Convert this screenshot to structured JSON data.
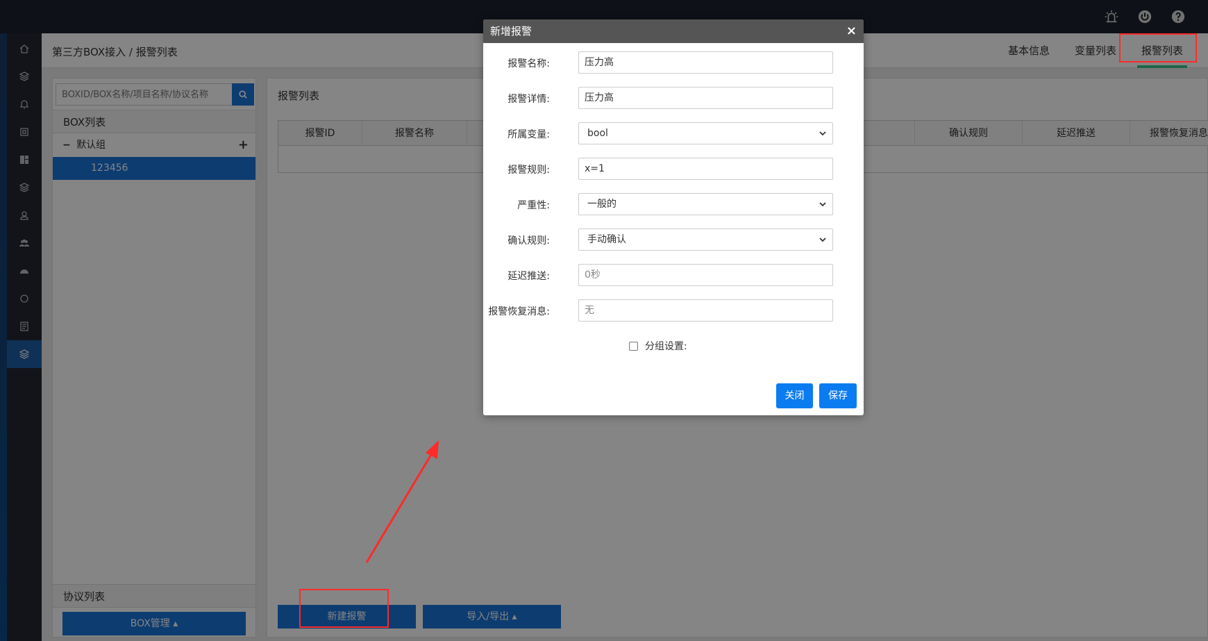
{
  "header": {
    "breadcrumb": "第三方BOX接入 / 报警列表",
    "tabs": [
      {
        "label": "基本信息"
      },
      {
        "label": "变量列表"
      },
      {
        "label": "报警列表"
      }
    ]
  },
  "top_icons": [
    "alarm-light-icon",
    "power-icon",
    "help-icon"
  ],
  "left_nav": [
    "home-icon",
    "layers-icon",
    "bell-icon",
    "device-icon",
    "dashboard-icon",
    "layers-icon",
    "user-icon",
    "users-icon",
    "gauge-icon",
    "cycle-icon",
    "report-icon",
    "layers-icon"
  ],
  "left_panel": {
    "search_placeholder": "BOXID/BOX名称/项目名称/协议名称",
    "box_list_title": "BOX列表",
    "group_name": "默认组",
    "group_collapse": "−",
    "group_add": "+",
    "box_item": "123456",
    "protocol_list_title": "协议列表",
    "box_mgmt_label": "BOX管理 ▴"
  },
  "main": {
    "title": "报警列表",
    "columns": [
      "报警ID",
      "报警名称",
      "确认规则",
      "延迟推送",
      "报警恢复消息"
    ],
    "new_alarm_label": "新建报警",
    "import_export_label": "导入/导出 ▴"
  },
  "modal": {
    "title": "新增报警",
    "close_symbol": "×",
    "fields": {
      "alarm_name": {
        "label": "报警名称:",
        "value": "压力高"
      },
      "alarm_detail": {
        "label": "报警详情:",
        "value": "压力高"
      },
      "variable": {
        "label": "所属变量:",
        "value": "bool"
      },
      "rule": {
        "label": "报警规则:",
        "value": "x=1"
      },
      "severity": {
        "label": "严重性:",
        "value": "一般的"
      },
      "confirm_rule": {
        "label": "确认规则:",
        "value": "手动确认"
      },
      "delay_push": {
        "label": "延迟推送:",
        "placeholder": "0秒"
      },
      "recovery_msg": {
        "label": "报警恢复消息:",
        "placeholder": "无"
      }
    },
    "group_setting_label": "分组设置:",
    "close_label": "关闭",
    "save_label": "保存"
  },
  "colors": {
    "accent": "#1a73d8",
    "modal_button": "#0b7cf0",
    "annotation": "#ff2a2a",
    "tab_underline": "#3cc38a"
  }
}
